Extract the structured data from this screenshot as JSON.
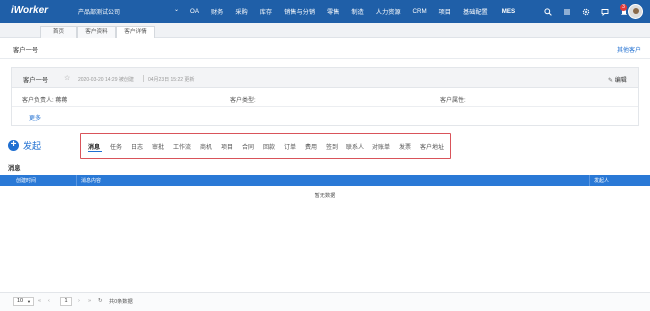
{
  "topbar": {
    "logo": "iWorker",
    "company": "产品部测试公司",
    "nav": [
      "OA",
      "财务",
      "采购",
      "库存",
      "销售与分销",
      "零售",
      "制造",
      "人力资源",
      "CRM",
      "项目",
      "基础配置",
      "MES"
    ],
    "badge_count": "3",
    "icons": [
      "search-icon",
      "list-icon",
      "settings-icon",
      "chat-icon",
      "bell-icon"
    ]
  },
  "page_tabs": [
    "首页",
    "客户资料",
    "客户详情"
  ],
  "header": {
    "title": "客户一号",
    "back_link": "其他客户"
  },
  "customer": {
    "name": "客户一号",
    "created": "2020-03-20 14:29 被创建",
    "updated": "04月23日 15:22 更新",
    "edit_label": "编辑",
    "owner_label": "客户负责人:",
    "owner_value": "蒋蒋",
    "type_label": "客户类型:",
    "attr_label": "客户属性:",
    "more_label": "更多"
  },
  "create_label": "发起",
  "subtabs": [
    "消息",
    "任务",
    "日志",
    "审批",
    "工作流",
    "商机",
    "项目",
    "合同",
    "回款",
    "订单",
    "费用",
    "签到",
    "联系人",
    "对账单",
    "发票",
    "客户地址"
  ],
  "section_label": "消息",
  "table": {
    "columns": [
      "创建时间",
      "消息内容",
      "发起人"
    ],
    "empty_text": "暂无数据"
  },
  "pagination": {
    "page_size": "10",
    "current_page": "1",
    "total_text": "共0条数据"
  },
  "colors": {
    "topbar": "#1f5fa8",
    "accent": "#1f6fd1",
    "table_header": "#2a79d6",
    "highlight_border": "#d9535a"
  }
}
